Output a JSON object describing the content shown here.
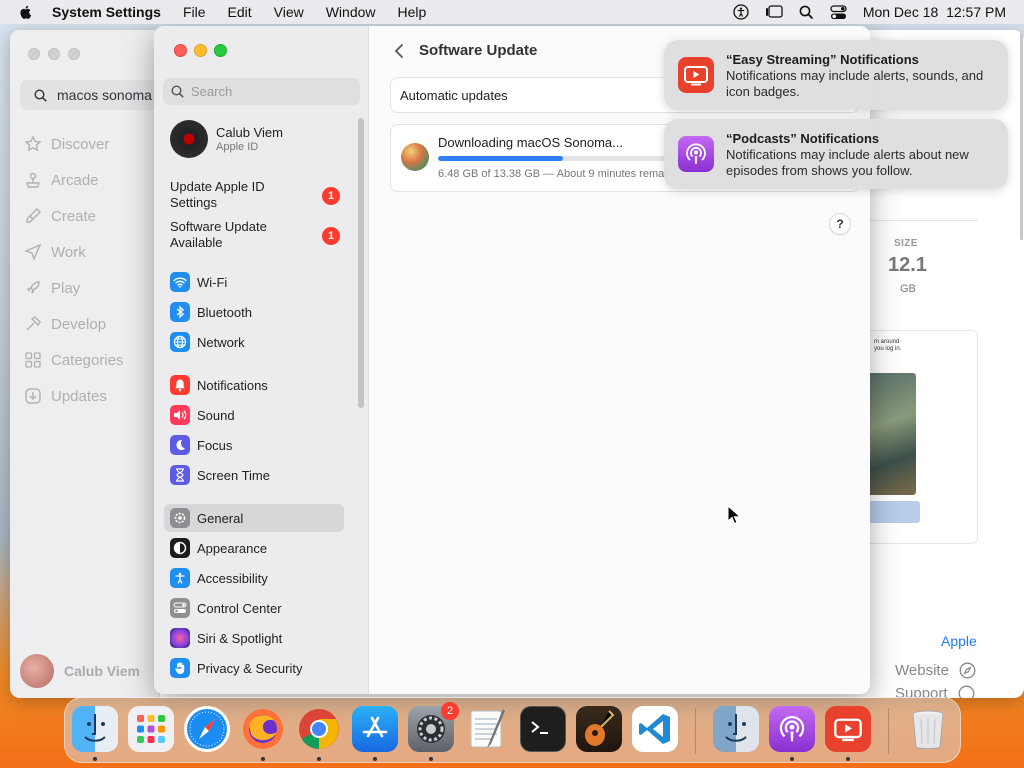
{
  "menubar": {
    "app_name": "System Settings",
    "menus": [
      "File",
      "Edit",
      "View",
      "Window",
      "Help"
    ],
    "clock": "Mon Dec 18  12:57 PM"
  },
  "appstore": {
    "search_value": "macos sonoma",
    "nav": [
      "Discover",
      "Arcade",
      "Create",
      "Work",
      "Play",
      "Develop",
      "Categories",
      "Updates"
    ],
    "user_name": "Calub Viem",
    "size_label": "SIZE",
    "size_value": "12.1",
    "size_unit": "GB",
    "preview_text": "m around\nyou log in.",
    "developer_link": "Apple",
    "website_label": "Website",
    "support_label": "Support"
  },
  "settings": {
    "search_placeholder": "Search",
    "profile": {
      "name": "Calub Viem",
      "sub": "Apple ID"
    },
    "alerts": [
      {
        "label": "Update Apple ID Settings",
        "badge": "1"
      },
      {
        "label": "Software Update Available",
        "badge": "1"
      }
    ],
    "items": [
      {
        "label": "Wi-Fi",
        "color": "#1f8ef1"
      },
      {
        "label": "Bluetooth",
        "color": "#1f8ef1"
      },
      {
        "label": "Network",
        "color": "#1f8ef1"
      },
      {
        "label": "Notifications",
        "color": "#ff3b30"
      },
      {
        "label": "Sound",
        "color": "#ff3b5c"
      },
      {
        "label": "Focus",
        "color": "#5e5ce6"
      },
      {
        "label": "Screen Time",
        "color": "#5e5ce6"
      },
      {
        "label": "General",
        "color": "#8e8e93"
      },
      {
        "label": "Appearance",
        "color": "#1c1c1e"
      },
      {
        "label": "Accessibility",
        "color": "#1f8ef1"
      },
      {
        "label": "Control Center",
        "color": "#8e8e93"
      },
      {
        "label": "Siri & Spotlight",
        "color": "#b44cc9"
      },
      {
        "label": "Privacy & Security",
        "color": "#1f8ef1"
      }
    ],
    "selected_item": "General",
    "page_title": "Software Update",
    "automatic_updates_label": "Automatic updates",
    "download": {
      "title": "Downloading macOS Sonoma...",
      "progress": 0.48,
      "status": "6.48 GB of 13.38 GB — About 9 minutes remaining"
    },
    "help": "?"
  },
  "notifications": [
    {
      "title": "“Easy Streaming” Notifications",
      "body": "Notifications may include alerts, sounds, and icon badges.",
      "icon": "easy-streaming-icon",
      "color": "#e8412c"
    },
    {
      "title": "“Podcasts” Notifications",
      "body": "Notifications may include alerts about new episodes from shows you follow.",
      "icon": "podcasts-icon",
      "color": "#9b3fd6"
    }
  ],
  "dock": {
    "apps": [
      "Finder",
      "Launchpad",
      "Safari",
      "Firefox",
      "Chrome",
      "App Store",
      "System Settings",
      "TextEdit",
      "Terminal",
      "GarageBand",
      "Visual Studio Code",
      "Finder Recent",
      "Podcasts",
      "Easy Streaming",
      "Trash"
    ],
    "settings_badge": "2"
  }
}
